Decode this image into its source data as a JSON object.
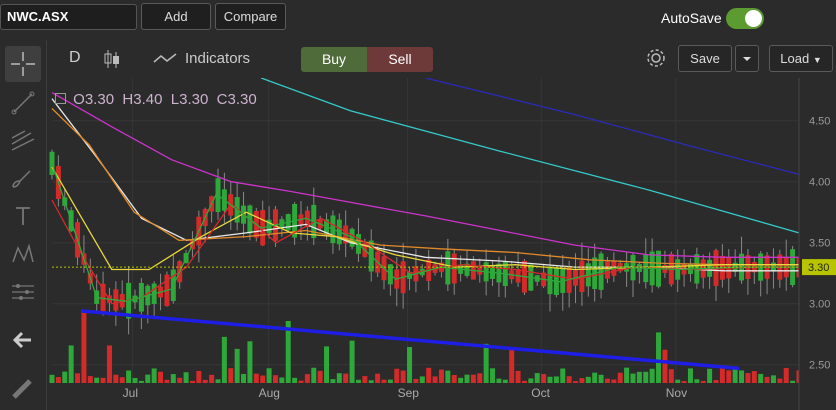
{
  "topbar": {
    "symbol": "NWC.ASX",
    "add_label": "Add",
    "compare_label": "Compare",
    "autosave_label": "AutoSave",
    "autosave_on": true
  },
  "left_tools": [
    "crosshair-icon",
    "line-tool-icon",
    "fib-tool-icon",
    "brush-icon",
    "text-icon",
    "pattern-icon",
    "measure-icon",
    "back-arrow-icon",
    "ruler-icon"
  ],
  "toolbar": {
    "interval": "D",
    "indicators_label": "Indicators",
    "buy_label": "Buy",
    "sell_label": "Sell",
    "save_label": "Save",
    "load_label": "Load"
  },
  "ohlc": {
    "o_label": "O",
    "o": "3.30",
    "h_label": "H",
    "h": "3.40",
    "l_label": "L",
    "l": "3.30",
    "c_label": "C",
    "c": "3.30"
  },
  "colors": {
    "up": "#2ea83a",
    "down": "#d42a2a",
    "trendline": "#1e1ee6",
    "last_price_bg": "#b8c400",
    "bg": "#2b2b2b"
  },
  "chart_data": {
    "type": "candlestick",
    "y_ticks": [
      4.5,
      4.0,
      3.5,
      3.0,
      2.5
    ],
    "y_tick_labels": [
      "4.50",
      "4.00",
      "3.50",
      "3.00",
      "2.50"
    ],
    "x_labels": [
      "Jul",
      "Aug",
      "Sep",
      "Oct",
      "Nov"
    ],
    "last_price": "3.30",
    "ylim": [
      2.35,
      4.85
    ],
    "series": [
      {
        "name": "ma-cyan",
        "color": "#35c9c9",
        "points": [
          [
            0.28,
            4.85
          ],
          [
            0.4,
            4.58
          ],
          [
            0.6,
            4.25
          ],
          [
            0.8,
            3.93
          ],
          [
            1.0,
            3.58
          ]
        ]
      },
      {
        "name": "ma-blue",
        "color": "#2a2ab8",
        "points": [
          [
            0.5,
            4.85
          ],
          [
            0.7,
            4.55
          ],
          [
            0.85,
            4.3
          ],
          [
            1.0,
            4.06
          ]
        ]
      },
      {
        "name": "ma-magenta",
        "color": "#cc33cc",
        "points": [
          [
            0.0,
            4.73
          ],
          [
            0.08,
            4.45
          ],
          [
            0.16,
            4.18
          ],
          [
            0.24,
            4.0
          ],
          [
            0.32,
            3.92
          ],
          [
            0.4,
            3.83
          ],
          [
            0.5,
            3.72
          ],
          [
            0.6,
            3.6
          ],
          [
            0.7,
            3.48
          ],
          [
            0.8,
            3.4
          ],
          [
            0.9,
            3.38
          ],
          [
            1.0,
            3.38
          ]
        ]
      },
      {
        "name": "ma-white",
        "color": "#e8e8e8",
        "points": [
          [
            0.0,
            4.68
          ],
          [
            0.06,
            4.2
          ],
          [
            0.12,
            3.7
          ],
          [
            0.18,
            3.52
          ],
          [
            0.26,
            3.58
          ],
          [
            0.34,
            3.65
          ],
          [
            0.4,
            3.5
          ],
          [
            0.5,
            3.38
          ],
          [
            0.6,
            3.35
          ],
          [
            0.7,
            3.3
          ],
          [
            0.8,
            3.3
          ],
          [
            0.9,
            3.27
          ],
          [
            1.0,
            3.27
          ]
        ]
      },
      {
        "name": "ma-orange",
        "color": "#e08a2a",
        "points": [
          [
            0.0,
            4.6
          ],
          [
            0.05,
            4.3
          ],
          [
            0.11,
            3.75
          ],
          [
            0.17,
            3.52
          ],
          [
            0.26,
            3.55
          ],
          [
            0.34,
            3.6
          ],
          [
            0.44,
            3.48
          ],
          [
            0.52,
            3.45
          ],
          [
            0.62,
            3.42
          ],
          [
            0.72,
            3.36
          ],
          [
            0.82,
            3.33
          ],
          [
            0.9,
            3.32
          ],
          [
            1.0,
            3.32
          ]
        ]
      },
      {
        "name": "ma-yellow",
        "color": "#e8d83a",
        "points": [
          [
            0.0,
            4.12
          ],
          [
            0.04,
            3.7
          ],
          [
            0.08,
            3.28
          ],
          [
            0.13,
            3.28
          ],
          [
            0.2,
            3.55
          ],
          [
            0.26,
            3.75
          ],
          [
            0.32,
            3.58
          ],
          [
            0.38,
            3.55
          ],
          [
            0.46,
            3.4
          ],
          [
            0.54,
            3.3
          ],
          [
            0.62,
            3.32
          ],
          [
            0.7,
            3.28
          ],
          [
            0.8,
            3.3
          ],
          [
            0.9,
            3.32
          ],
          [
            1.0,
            3.32
          ]
        ]
      },
      {
        "name": "ma-red",
        "color": "#d42a2a",
        "points": [
          [
            0.0,
            3.85
          ],
          [
            0.04,
            3.4
          ],
          [
            0.08,
            3.0
          ],
          [
            0.12,
            3.05
          ],
          [
            0.18,
            3.3
          ],
          [
            0.24,
            3.82
          ],
          [
            0.3,
            3.5
          ],
          [
            0.36,
            3.7
          ],
          [
            0.42,
            3.5
          ],
          [
            0.48,
            3.25
          ],
          [
            0.55,
            3.32
          ],
          [
            0.62,
            3.28
          ],
          [
            0.7,
            3.2
          ],
          [
            0.78,
            3.3
          ],
          [
            0.86,
            3.28
          ],
          [
            0.94,
            3.3
          ],
          [
            1.0,
            3.3
          ]
        ]
      },
      {
        "name": "ma-green",
        "color": "#2ea83a",
        "points": [
          [
            0.0,
            4.15
          ],
          [
            0.03,
            3.6
          ],
          [
            0.06,
            3.05
          ],
          [
            0.1,
            3.02
          ],
          [
            0.16,
            3.12
          ],
          [
            0.22,
            3.9
          ],
          [
            0.28,
            3.62
          ],
          [
            0.34,
            3.7
          ],
          [
            0.4,
            3.55
          ],
          [
            0.46,
            3.2
          ],
          [
            0.52,
            3.3
          ],
          [
            0.6,
            3.25
          ],
          [
            0.68,
            3.18
          ],
          [
            0.76,
            3.3
          ],
          [
            0.84,
            3.28
          ],
          [
            0.92,
            3.3
          ],
          [
            1.0,
            3.3
          ]
        ]
      }
    ],
    "trendline": {
      "from": [
        0.04,
        2.94
      ],
      "to": [
        0.92,
        2.47
      ]
    }
  }
}
